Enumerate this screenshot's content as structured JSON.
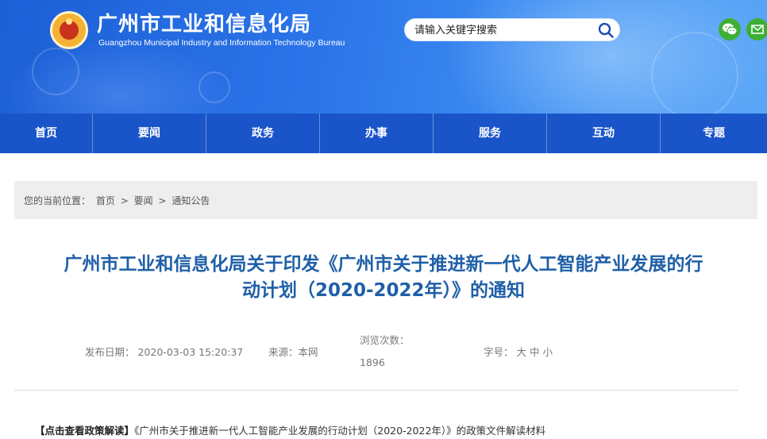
{
  "header": {
    "title": "广州市工业和信息化局",
    "subtitle": "Guangzhou Municipal Industry and Information Technology Bureau",
    "brand_color": "#2a73e8",
    "logo_icon": "emblem-icon"
  },
  "search": {
    "placeholder": "请输入关键字搜索",
    "icon": "search-icon"
  },
  "share": {
    "wechat_icon": "wechat-icon",
    "mail_icon": "mail-icon",
    "color": "#3cb034"
  },
  "nav": {
    "items": [
      {
        "label": "首页"
      },
      {
        "label": "要闻"
      },
      {
        "label": "政务"
      },
      {
        "label": "办事"
      },
      {
        "label": "服务"
      },
      {
        "label": "互动"
      },
      {
        "label": "专题"
      }
    ],
    "color": "#1a54c9"
  },
  "breadcrumb": {
    "prefix": "您的当前位置：",
    "items": [
      "首页",
      "要闻",
      "通知公告"
    ],
    "separator": ">"
  },
  "article": {
    "title_line1": "广州市工业和信息化局关于印发《广州市关于推进新一代人工智能产业发展的行",
    "title_line2": "动计划（2020-2022年）》的通知",
    "title_color": "#1f5fa7",
    "publish_label": "发布日期：",
    "publish_value": "2020-03-03 15:20:37",
    "source_label": "来源：",
    "source_value": "本网",
    "views_label": "浏览次数：",
    "views_value": "1896",
    "fontsize_label": "字号：",
    "fontsize_options": [
      "大",
      "中",
      "小"
    ]
  },
  "policy": {
    "tag": "【点击查看政策解读】",
    "text": "《广州市关于推进新一代人工智能产业发展的行动计划（2020-2022年）》的政策文件解读材料"
  }
}
